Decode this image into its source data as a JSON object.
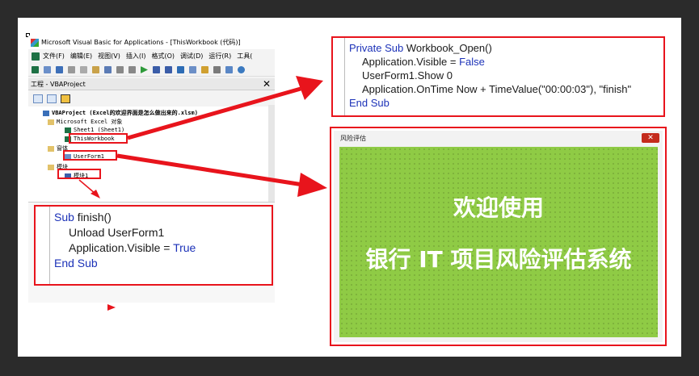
{
  "ide": {
    "window_title": "Microsoft Visual Basic for Applications - [ThisWorkbook (代码)]",
    "menu": [
      "文件(F)",
      "编辑(E)",
      "视图(V)",
      "插入(I)",
      "格式(O)",
      "调试(D)",
      "运行(R)",
      "工具("
    ],
    "project_panel_title": "工程 - VBAProject",
    "close_glyph": "✕",
    "tree": {
      "root": "VBAProject (Excel的欢迎界面是怎么做出来的.xlsm)",
      "excel_objects": "Microsoft Excel 对象",
      "sheet1": "Sheet1 (Sheet1)",
      "thisworkbook": "ThisWorkbook",
      "forms": "窗体",
      "userform1": "UserForm1",
      "modules": "模块",
      "module1": "模块1"
    }
  },
  "code_workbook_open": {
    "line1_kw": "Private Sub",
    "line1_rest": " Workbook_Open()",
    "line2_a": "Application.Visible = ",
    "line2_kw": "False",
    "line3": "UserForm1.Show 0",
    "line4": "Application.OnTime Now + TimeValue(\"00:00:03\"), \"finish\"",
    "line5_kw": "End Sub"
  },
  "code_finish": {
    "line1_kw": "Sub",
    "line1_rest": " finish()",
    "line2": "Unload UserForm1",
    "line3_a": "Application.Visible = ",
    "line3_kw": "True",
    "line4_kw": "End Sub"
  },
  "userform": {
    "title": "风险评估",
    "close_glyph": "✕",
    "welcome": "欢迎使用",
    "system_name": "银行 IT 项目风险评估系统"
  },
  "colors": {
    "highlight_red": "#e8141c",
    "keyword_blue": "#1c32b8",
    "form_green": "#8fcb45"
  }
}
